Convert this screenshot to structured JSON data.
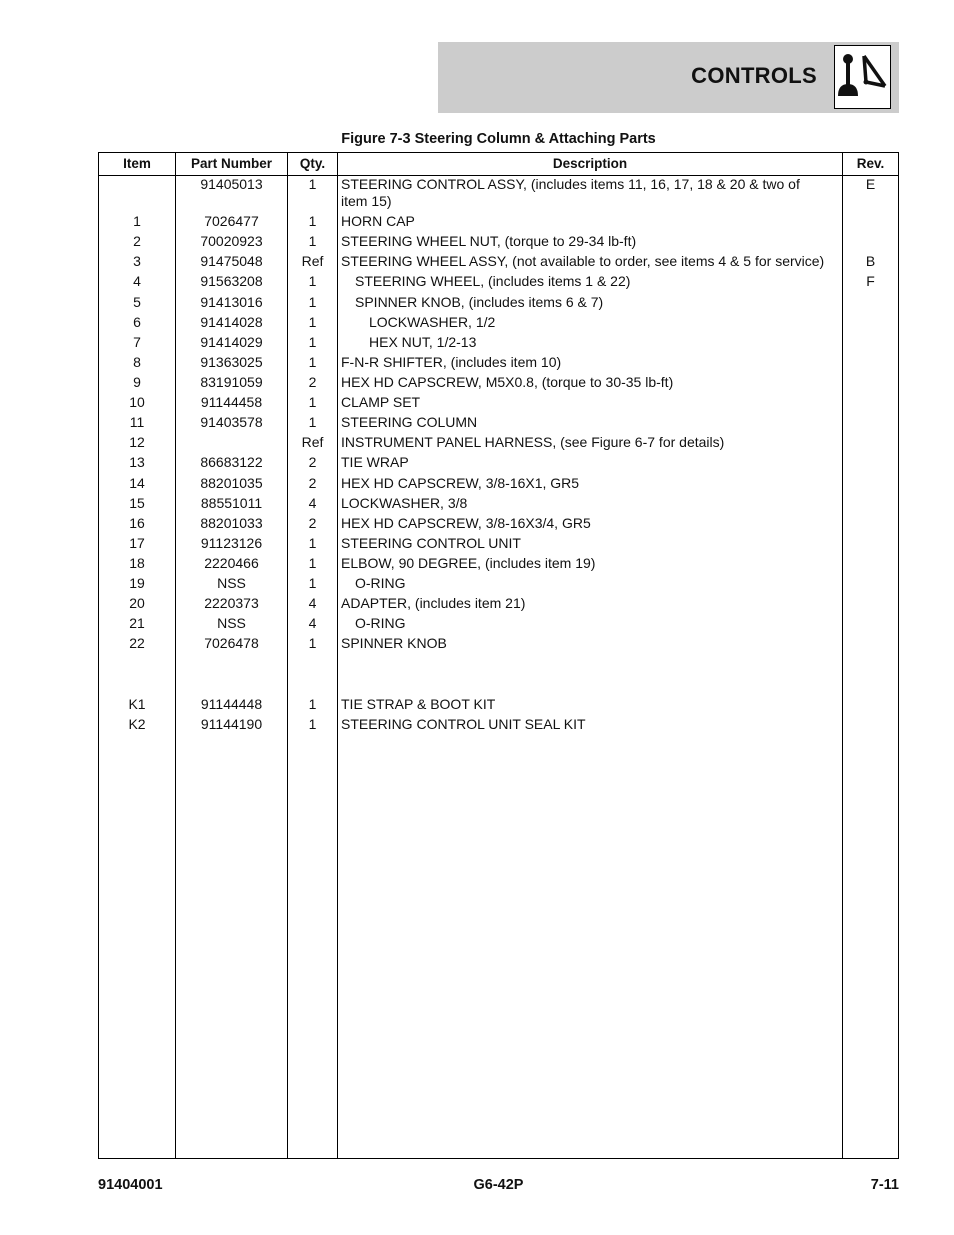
{
  "header": {
    "section_title": "CONTROLS",
    "icon": "controls-joystick-icon"
  },
  "figure_title": "Figure 7-3 Steering Column & Attaching Parts",
  "table": {
    "columns": [
      "Item",
      "Part Number",
      "Qty.",
      "Description",
      "Rev."
    ],
    "rows": [
      {
        "item": "",
        "part": "91405013",
        "qty": "1",
        "desc": "STEERING CONTROL ASSY, (includes items 11, 16, 17, 18 & 20 & two of item 15)",
        "desc_line1": "STEERING CONTROL ASSY, (includes items 11, 16, 17, 18 & 20 & two of",
        "desc_line2": "item 15)",
        "rev": "E",
        "indent": 0
      },
      {
        "item": "1",
        "part": "7026477",
        "qty": "1",
        "desc": "HORN CAP",
        "rev": "",
        "indent": 0
      },
      {
        "item": "2",
        "part": "70020923",
        "qty": "1",
        "desc": "STEERING WHEEL NUT, (torque to 29-34 lb-ft)",
        "rev": "",
        "indent": 0
      },
      {
        "item": "3",
        "part": "91475048",
        "qty": "Ref",
        "desc": "STEERING WHEEL ASSY, (not available to order, see items 4 & 5 for service)",
        "rev": "B",
        "indent": 0
      },
      {
        "item": "4",
        "part": "91563208",
        "qty": "1",
        "desc": "STEERING WHEEL, (includes items 1 & 22)",
        "rev": "F",
        "indent": 1
      },
      {
        "item": "5",
        "part": "91413016",
        "qty": "1",
        "desc": "SPINNER KNOB, (includes items 6 & 7)",
        "rev": "",
        "indent": 1
      },
      {
        "item": "6",
        "part": "91414028",
        "qty": "1",
        "desc": "LOCKWASHER, 1/2",
        "rev": "",
        "indent": 2
      },
      {
        "item": "7",
        "part": "91414029",
        "qty": "1",
        "desc": "HEX NUT, 1/2-13",
        "rev": "",
        "indent": 2
      },
      {
        "item": "8",
        "part": "91363025",
        "qty": "1",
        "desc": "F-N-R SHIFTER, (includes item 10)",
        "rev": "",
        "indent": 0
      },
      {
        "item": "9",
        "part": "83191059",
        "qty": "2",
        "desc": "HEX HD CAPSCREW, M5X0.8, (torque to 30-35 lb-ft)",
        "rev": "",
        "indent": 0
      },
      {
        "item": "10",
        "part": "91144458",
        "qty": "1",
        "desc": "CLAMP SET",
        "rev": "",
        "indent": 0
      },
      {
        "item": "11",
        "part": "91403578",
        "qty": "1",
        "desc": "STEERING COLUMN",
        "rev": "",
        "indent": 0
      },
      {
        "item": "12",
        "part": "",
        "qty": "Ref",
        "desc": "INSTRUMENT PANEL HARNESS, (see Figure 6-7 for details)",
        "rev": "",
        "indent": 0
      },
      {
        "item": "13",
        "part": "86683122",
        "qty": "2",
        "desc": "TIE WRAP",
        "rev": "",
        "indent": 0
      },
      {
        "item": "14",
        "part": "88201035",
        "qty": "2",
        "desc": "HEX HD CAPSCREW, 3/8-16X1, GR5",
        "rev": "",
        "indent": 0
      },
      {
        "item": "15",
        "part": "88551011",
        "qty": "4",
        "desc": "LOCKWASHER, 3/8",
        "rev": "",
        "indent": 0
      },
      {
        "item": "16",
        "part": "88201033",
        "qty": "2",
        "desc": "HEX HD CAPSCREW, 3/8-16X3/4, GR5",
        "rev": "",
        "indent": 0
      },
      {
        "item": "17",
        "part": "91123126",
        "qty": "1",
        "desc": "STEERING CONTROL UNIT",
        "rev": "",
        "indent": 0
      },
      {
        "item": "18",
        "part": "2220466",
        "qty": "1",
        "desc": "ELBOW, 90 DEGREE, (includes item 19)",
        "rev": "",
        "indent": 0
      },
      {
        "item": "19",
        "part": "NSS",
        "qty": "1",
        "desc": "O-RING",
        "rev": "",
        "indent": 1
      },
      {
        "item": "20",
        "part": "2220373",
        "qty": "4",
        "desc": "ADAPTER, (includes item 21)",
        "rev": "",
        "indent": 0
      },
      {
        "item": "21",
        "part": "NSS",
        "qty": "4",
        "desc": "O-RING",
        "rev": "",
        "indent": 1
      },
      {
        "item": "22",
        "part": "7026478",
        "qty": "1",
        "desc": "SPINNER KNOB",
        "rev": "",
        "indent": 0
      },
      {
        "item": "K1",
        "part": "91144448",
        "qty": "1",
        "desc": "TIE STRAP & BOOT KIT",
        "rev": "",
        "indent": 0
      },
      {
        "item": "K2",
        "part": "91144190",
        "qty": "1",
        "desc": "STEERING CONTROL UNIT SEAL KIT",
        "rev": "",
        "indent": 0
      }
    ]
  },
  "footer": {
    "left": "91404001",
    "center": "G6-42P",
    "right": "7-11"
  }
}
